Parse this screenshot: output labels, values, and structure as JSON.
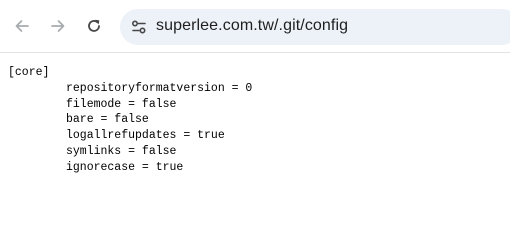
{
  "browser": {
    "url": "superlee.com.tw/.git/config",
    "icons": {
      "back": "back-arrow-icon",
      "forward": "forward-arrow-icon",
      "reload": "reload-icon",
      "site_info": "tune-icon"
    },
    "colors": {
      "omnibox_bg": "#edf1f8",
      "icon_enabled": "#474747",
      "icon_disabled": "#a8abae"
    }
  },
  "page": {
    "section": "[core]",
    "entries": [
      "repositoryformatversion = 0",
      "filemode = false",
      "bare = false",
      "logallrefupdates = true",
      "symlinks = false",
      "ignorecase = true"
    ]
  }
}
